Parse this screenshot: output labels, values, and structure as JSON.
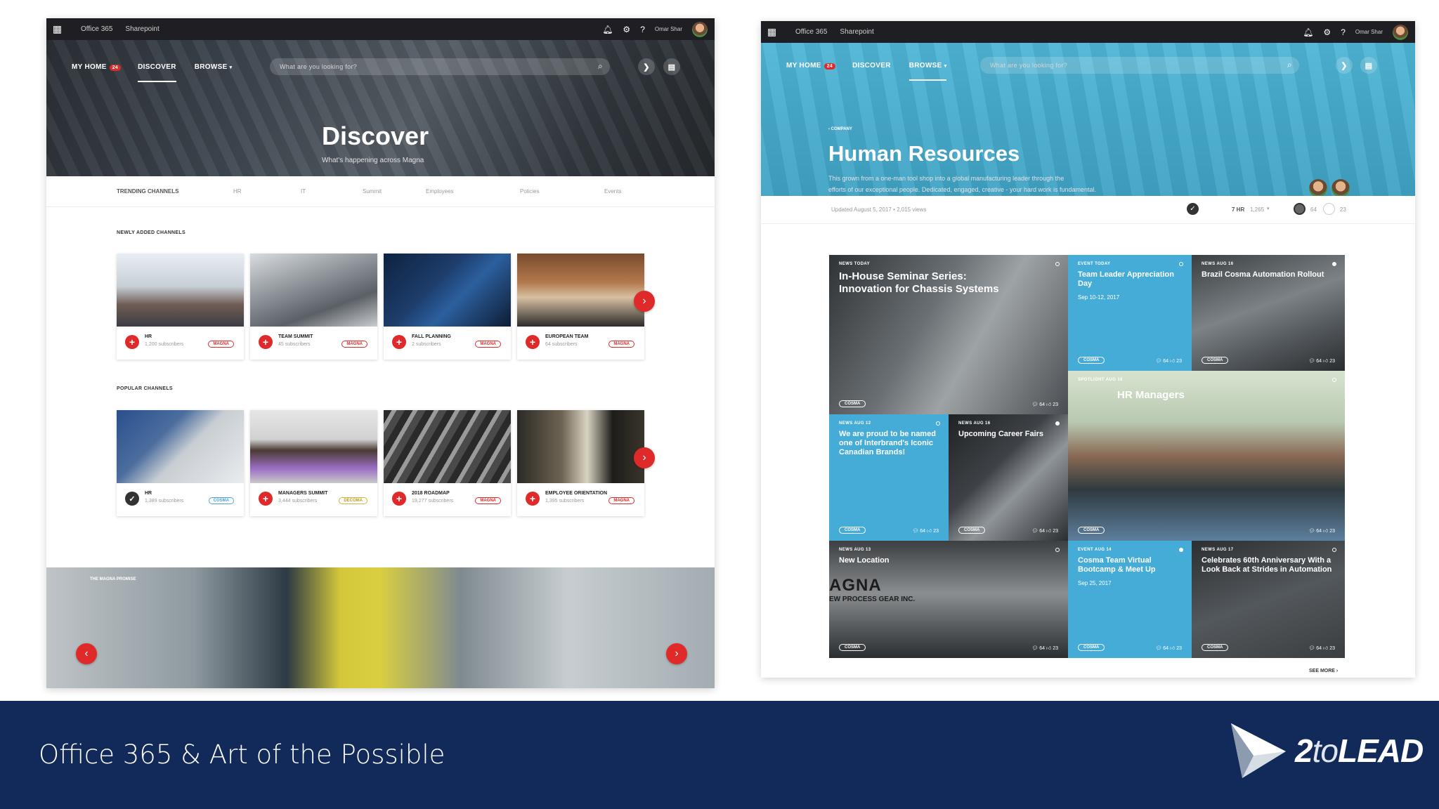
{
  "slide": {
    "title": "Office 365 & Art of the Possible",
    "brand": {
      "prefix": "2",
      "mid": "to",
      "suffix": "LEAD"
    }
  },
  "suite": {
    "app": "Office 365",
    "site": "Sharepoint",
    "user": "Omar Shar"
  },
  "nav": {
    "my_home": "MY HOME",
    "badge": "24",
    "discover": "DISCOVER",
    "browse": "BROWSE",
    "search_placeholder": "What are you looking for?"
  },
  "discover": {
    "title": "Discover",
    "subtitle": "What's happening across Magna",
    "trending_label": "TRENDING CHANNELS",
    "trending": [
      "HR",
      "IT",
      "Summit",
      "Employees",
      "Policies",
      "Events"
    ],
    "newly_added_label": "NEWLY ADDED CHANNELS",
    "popular_label": "POPULAR CHANNELS",
    "newly_added": [
      {
        "name": "HR",
        "sub": "1,200 subscribers",
        "tag": "MAGNA"
      },
      {
        "name": "TEAM SUMMIT",
        "sub": "45 subscribers",
        "tag": "MAGNA"
      },
      {
        "name": "FALL PLANNING",
        "sub": "2 subscribers",
        "tag": "MAGNA"
      },
      {
        "name": "EUROPEAN TEAM",
        "sub": "64 subscribers",
        "tag": "MAGNA"
      }
    ],
    "popular": [
      {
        "name": "HR",
        "sub": "1,389 subscribers",
        "tag": "COSMA"
      },
      {
        "name": "MANAGERS SUMMIT",
        "sub": "3,444 subscribers",
        "tag": "DECOMA"
      },
      {
        "name": "2018 ROADMAP",
        "sub": "19,277 subscribers",
        "tag": "MAGNA"
      },
      {
        "name": "EMPLOYEE ORIENTATION",
        "sub": "1,395 subscribers",
        "tag": "MAGNA"
      }
    ],
    "bottom_label": "THE MAGNA PROMISE"
  },
  "hr": {
    "crumb": "COMPANY",
    "title": "Human Resources",
    "desc_line1": "This grown from a one-man tool shop into a global manufacturing leader through the",
    "desc_line2": "efforts of our exceptional people. Dedicated, engaged, creative - your hard work is fundamental.",
    "updated": "Updated August 5, 2017  •  2,015 views",
    "follow": "7 HR",
    "follow_count": "1,265",
    "comments": "64",
    "likes": "23",
    "see_more": "SEE MORE",
    "tiles": [
      {
        "kicker": "NEWS  TODAY",
        "title": "In-House Seminar Series: Innovation for Chassis Systems",
        "pill": "COSMA",
        "c": "64",
        "l": "23"
      },
      {
        "kicker": "EVENT  TODAY",
        "title": "Team Leader Appreciation Day",
        "date": "Sep 10-12, 2017",
        "pill": "COSMA",
        "c": "64",
        "l": "23"
      },
      {
        "kicker": "NEWS  AUG 16",
        "title": "Brazil Cosma Automation Rollout",
        "pill": "COSMA",
        "c": "64",
        "l": "23"
      },
      {
        "kicker": "SPOTLIGHT  AUG 16",
        "title": "HR Managers",
        "pill": "COSMA",
        "c": "64",
        "l": "23"
      },
      {
        "kicker": "NEWS  AUG 12",
        "title": "We are proud to be named one of Interbrand's Iconic Canadian Brands!",
        "pill": "COSMA",
        "c": "64",
        "l": "23"
      },
      {
        "kicker": "NEWS  AUG 16",
        "title": "Upcoming Career Fairs",
        "pill": "COSMA",
        "c": "64",
        "l": "23"
      },
      {
        "kicker": "NEWS  AUG 13",
        "title": "New Location",
        "sign1": "AGNA",
        "sign2": "EW PROCESS GEAR INC.",
        "pill": "COSMA",
        "c": "64",
        "l": "23"
      },
      {
        "kicker": "EVENT  AUG 14",
        "title": "Cosma Team Virtual Bootcamp & Meet Up",
        "date": "Sep 25, 2017",
        "pill": "COSMA",
        "c": "64",
        "l": "23"
      },
      {
        "kicker": "NEWS  AUG 17",
        "title": "Celebrates 60th Anniversary With a Look Back at Strides in Automation",
        "pill": "COSMA",
        "c": "64",
        "l": "23"
      }
    ]
  },
  "colors": {
    "accent_red": "#e02a2a",
    "hr_blue": "#45acd8",
    "footer_navy": "#112a59"
  }
}
